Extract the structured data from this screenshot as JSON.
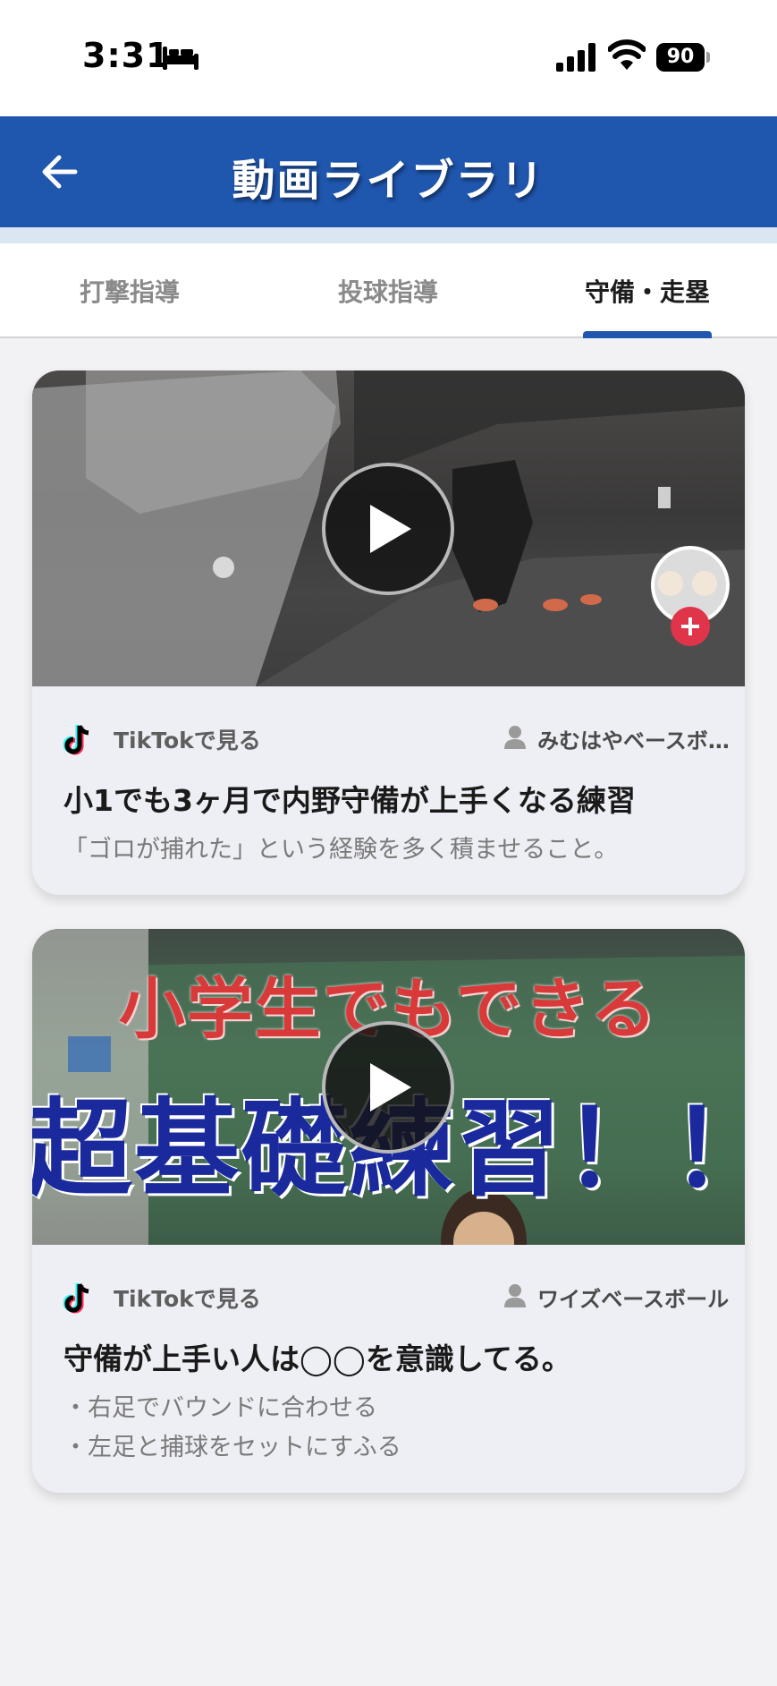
{
  "status_bar": {
    "time": "3:31",
    "battery": "90"
  },
  "header": {
    "title": "動画ライブラリ"
  },
  "tabs": [
    {
      "label": "打撃指導",
      "active": false
    },
    {
      "label": "投球指導",
      "active": false
    },
    {
      "label": "守備・走塁",
      "active": true
    }
  ],
  "videos": [
    {
      "source_label": "TikTokで見る",
      "author": "みむはやベースボール",
      "title": "小1でも3ヶ月で内野守備が上手くなる練習",
      "description": [
        "「ゴロが捕れた」という経験を多く積ませること。"
      ],
      "thumbnail_text": []
    },
    {
      "source_label": "TikTokで見る",
      "author": "ワイズベースボール",
      "title": "守備が上手い人は◯◯を意識してる。",
      "description": [
        "・右足でバウンドに合わせる",
        "・左足と捕球をセットにすふる"
      ],
      "thumbnail_text": [
        "小学生でもできる",
        "超基礎練習！！"
      ]
    }
  ],
  "colors": {
    "primary": "#1f56ae",
    "background": "#f2f2f4",
    "card": "#eeeff5"
  }
}
